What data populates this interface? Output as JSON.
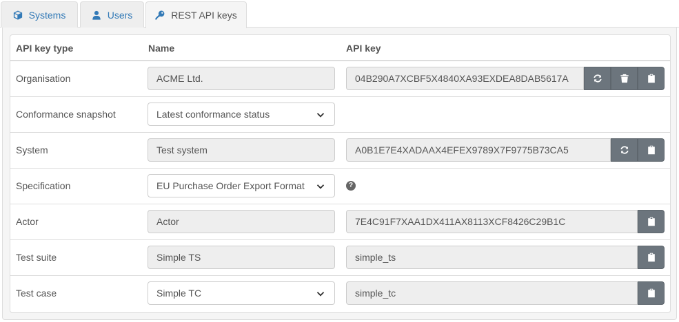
{
  "tabs": [
    {
      "label": "Systems",
      "icon": "cube-icon"
    },
    {
      "label": "Users",
      "icon": "user-icon"
    },
    {
      "label": "REST API keys",
      "icon": "key-icon"
    }
  ],
  "table": {
    "headers": {
      "type": "API key type",
      "name": "Name",
      "key": "API key"
    },
    "rows": [
      {
        "label": "Organisation",
        "name": "ACME Ltd.",
        "key": "04B290A7XCBF5X4840XA93EXDEA8DAB5617A"
      },
      {
        "label": "Conformance snapshot",
        "name": "Latest conformance status"
      },
      {
        "label": "System",
        "name": "Test system",
        "key": "A0B1E7E4XADAAX4EFEX9789X7F9775B73CA5"
      },
      {
        "label": "Specification",
        "name": "EU Purchase Order Export Format"
      },
      {
        "label": "Actor",
        "name": "Actor",
        "key": "7E4C91F7XAA1DX411AX8113XCF8426C29B1C"
      },
      {
        "label": "Test suite",
        "name": "Simple TS",
        "key": "simple_ts"
      },
      {
        "label": "Test case",
        "name": "Simple TC",
        "key": "simple_tc"
      }
    ]
  },
  "colors": {
    "link": "#337ab7",
    "button": "#6c757d",
    "readonly_bg": "#eeeeee"
  }
}
